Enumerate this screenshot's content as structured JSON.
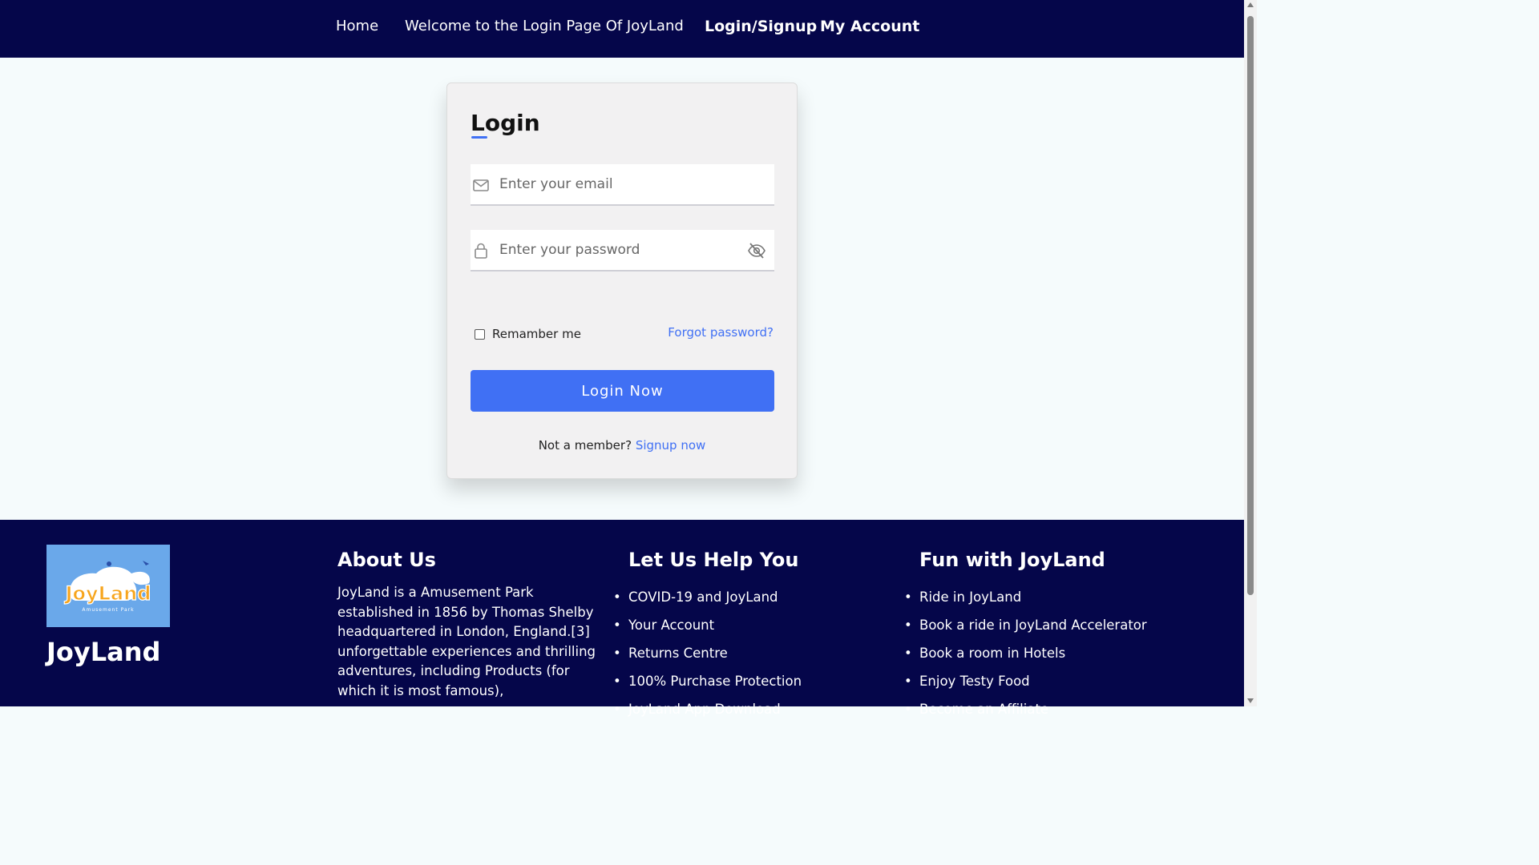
{
  "nav": {
    "home": "Home",
    "welcome": "Welcome to the Login Page Of JoyLand",
    "login_signup": "Login/Signup",
    "my_account": "My Account"
  },
  "login_form": {
    "title": "Login",
    "email_placeholder": "Enter your email",
    "password_placeholder": "Enter your password",
    "remember_label": "Remamber me",
    "remember_checked": false,
    "forgot_label": "Forgot password?",
    "submit_label": "Login Now",
    "not_member_text": "Not a member?",
    "signup_label": "Signup now"
  },
  "icons": {
    "email": "envelope-icon",
    "password": "lock-icon",
    "toggle_visibility": "eye-slash-icon"
  },
  "footer": {
    "logo_text": "JoyLand",
    "logo_subtext": "Amusement Park",
    "brand": "JoyLand",
    "about_title": "About Us",
    "about_text": "JoyLand is a Amusement Park established in 1856 by Thomas Shelby headquartered in London, England.[3] unforgettable experiences and thrilling adventures, including Products (for which it is most famous),",
    "help_title": "Let Us Help You",
    "help_items": [
      "COVID-19 and JoyLand",
      "Your Account",
      "Returns Centre",
      "100% Purchase Protection",
      "JoyLand App Download"
    ],
    "fun_title": "Fun with JoyLand",
    "fun_items": [
      "Ride in JoyLand",
      "Book a ride in JoyLand Accelerator",
      "Book a room in Hotels",
      "Enjoy Testy Food",
      "Become an Affiliate"
    ]
  },
  "colors": {
    "navy": "#05064a",
    "accent": "#4070f4",
    "page_bg": "#f5fbfc",
    "card_bg": "#f2f1f2"
  }
}
